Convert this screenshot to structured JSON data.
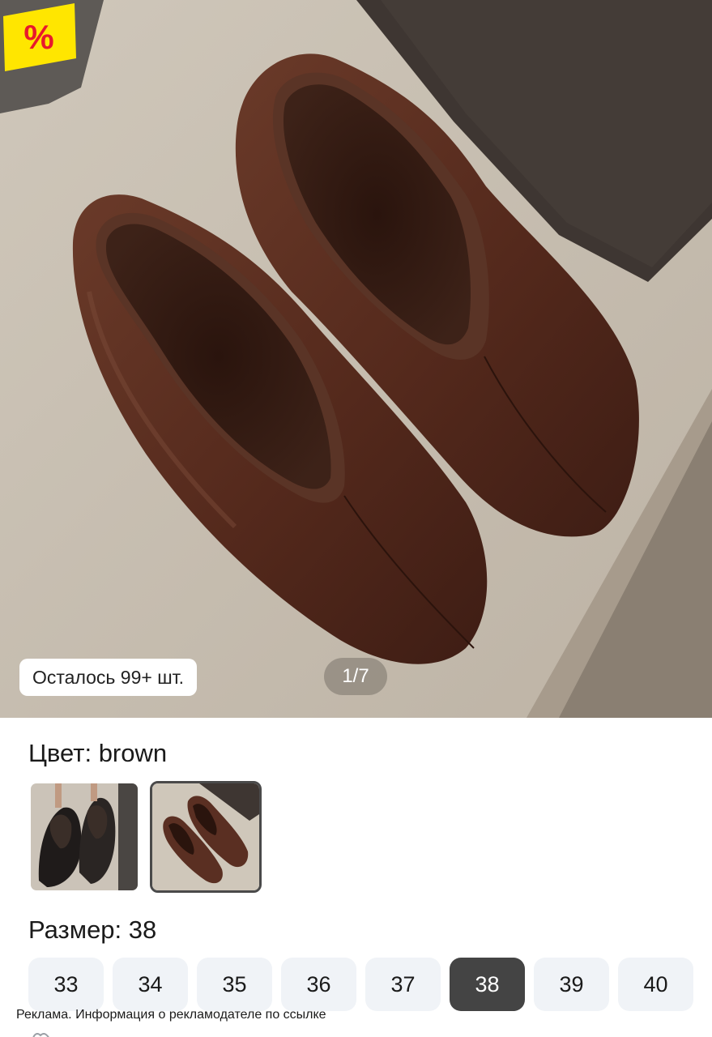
{
  "gallery": {
    "stock_label": "Осталось 99+ шт.",
    "pager_label": "1/7",
    "sale_badge_text": "%",
    "sale_badge_color": "#ffe600",
    "sale_badge_text_color": "#e8192c"
  },
  "color_section": {
    "title": "Цвет: brown",
    "options": [
      {
        "name": "black",
        "selected": false
      },
      {
        "name": "brown",
        "selected": true
      }
    ]
  },
  "size_section": {
    "title": "Размер: 38",
    "sizes": [
      "33",
      "34",
      "35",
      "36",
      "37",
      "38",
      "39",
      "40"
    ],
    "selected": "38"
  },
  "ad_notice": "Реклама. Информация о рекламодателе по ссылке",
  "colors": {
    "chip_bg": "#f0f3f7",
    "chip_selected_bg": "#444444",
    "shoe_brown": "#5a2f22"
  }
}
